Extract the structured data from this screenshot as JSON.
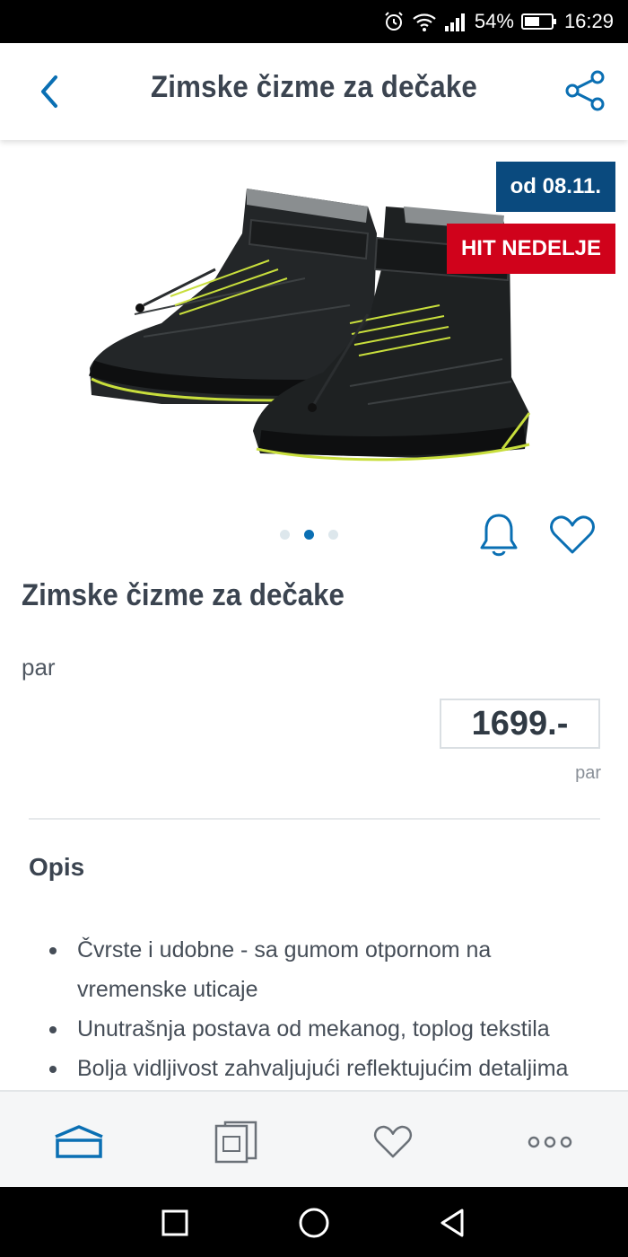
{
  "status_bar": {
    "battery_percent": "54%",
    "time": "16:29",
    "icons": [
      "alarm-icon",
      "wifi-icon",
      "signal-icon",
      "battery-icon"
    ]
  },
  "header": {
    "title": "Zimske čizme za dečake",
    "back_icon": "chevron-left-icon",
    "share_icon": "share-icon"
  },
  "gallery": {
    "badge_date": "od 08.11.",
    "badge_hit": "HIT NEDELJE",
    "slide_count": 3,
    "active_slide": 2,
    "colors": {
      "date_badge": "#0a4a7e",
      "hit_badge": "#d0021b",
      "accent": "#0a6fb3"
    }
  },
  "product": {
    "title": "Zimske čizme za dečake",
    "unit": "par",
    "price": "1699.-",
    "price_unit": "par"
  },
  "description": {
    "heading": "Opis",
    "items": [
      "Čvrste i udobne - sa gumom otpornom na vremenske uticaje",
      "Unutrašnja postava od mekanog, toplog tekstila",
      "Bolja vidljivost zahvaljujući reflektujućim detaljima"
    ]
  },
  "bottom_nav": {
    "items": [
      "home-icon",
      "leaflet-icon",
      "favorites-icon",
      "more-icon"
    ]
  },
  "system_nav": {
    "items": [
      "recents-icon",
      "home-circle-icon",
      "back-triangle-icon"
    ]
  }
}
